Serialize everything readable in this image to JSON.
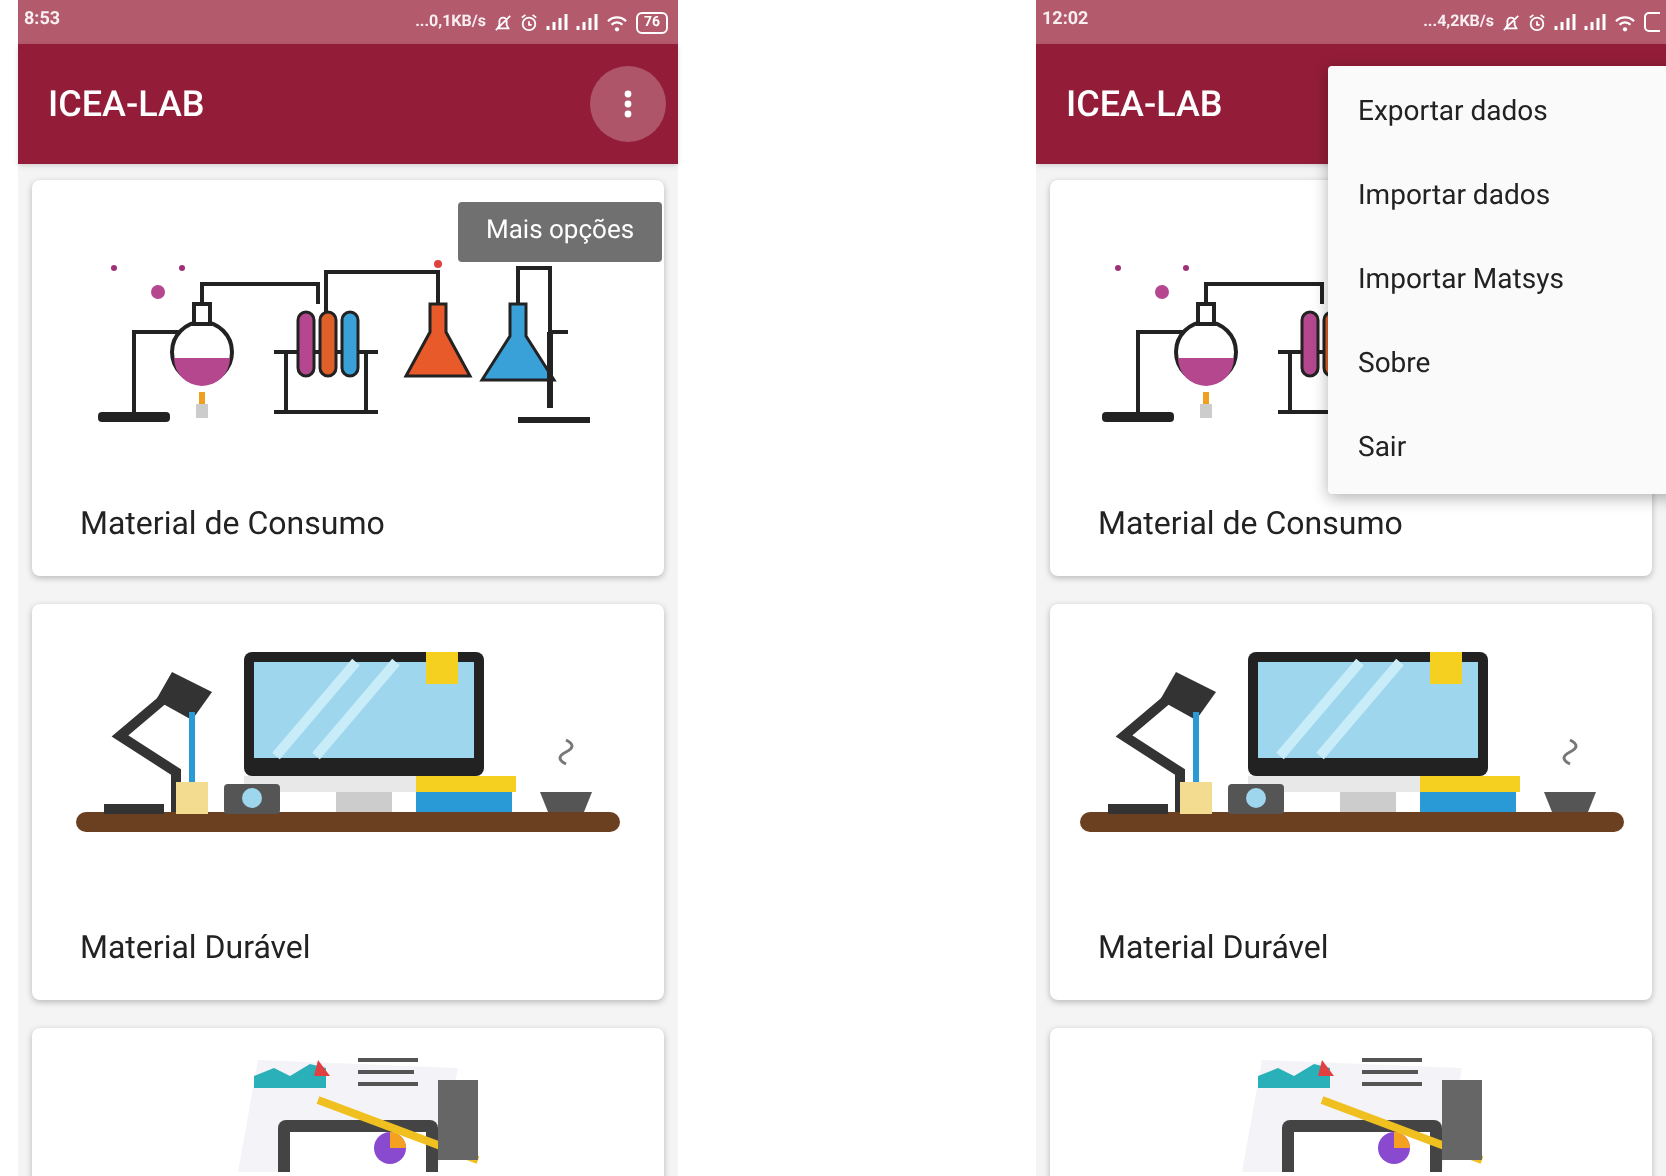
{
  "phones": [
    {
      "status_bar": {
        "time": "8:53",
        "net_speed": "...0,1KB/s",
        "battery": "76"
      },
      "app_bar": {
        "title": "ICEA-LAB",
        "menu_pressed": true
      },
      "tooltip": "Mais opções",
      "cards": [
        {
          "kind": "lab",
          "title": "Material de Consumo"
        },
        {
          "kind": "desk",
          "title": "Material Durável"
        },
        {
          "kind": "documents"
        }
      ]
    },
    {
      "status_bar": {
        "time": "12:02",
        "net_speed": "...4,2KB/s"
      },
      "app_bar": {
        "title": "ICEA-LAB"
      },
      "menu": [
        "Exportar dados",
        "Importar dados",
        "Importar Matsys",
        "Sobre",
        "Sair"
      ],
      "cards": [
        {
          "kind": "lab",
          "title": "Material de Consumo"
        },
        {
          "kind": "desk",
          "title": "Material Durável"
        },
        {
          "kind": "documents"
        }
      ]
    }
  ]
}
